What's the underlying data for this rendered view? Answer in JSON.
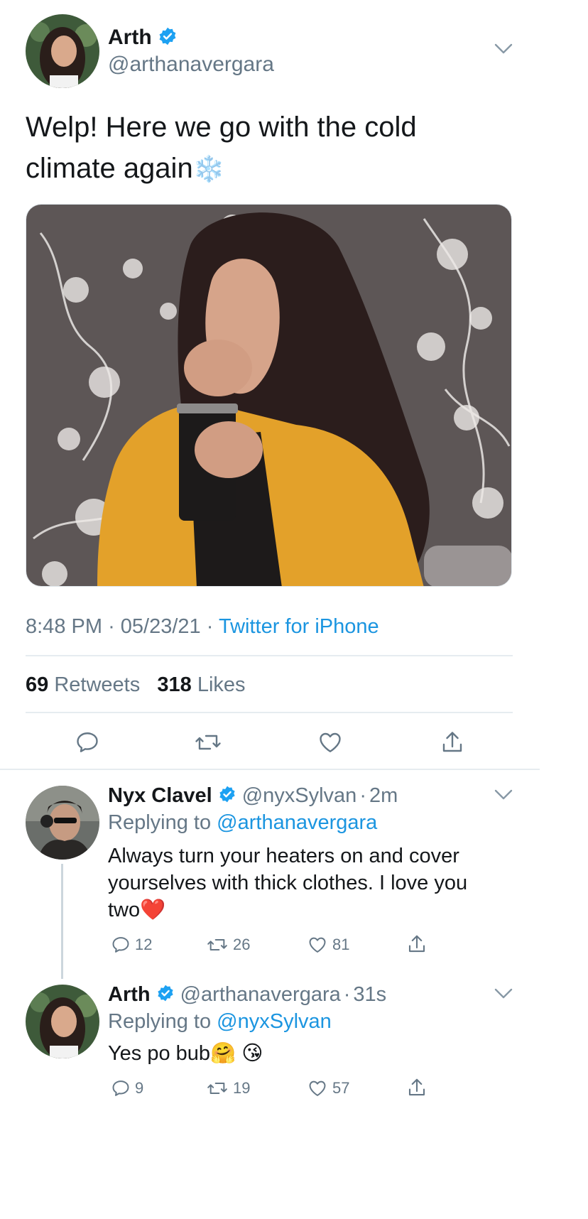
{
  "main_tweet": {
    "display_name": "Arth",
    "handle": "@arthanavergara",
    "text_line1": "Welp! Here we go with the cold",
    "text_line2": "climate again",
    "emoji_snowflake": "❄️",
    "time": "8:48 PM",
    "date": "05/23/21",
    "source": "Twitter for iPhone",
    "separator": "·",
    "retweets_count": "69",
    "retweets_label": "Retweets",
    "likes_count": "318",
    "likes_label": "Likes"
  },
  "replies": [
    {
      "display_name": "Nyx Clavel",
      "handle": "@nyxSylvan",
      "time": "2m",
      "replying_prefix": "Replying to",
      "replying_to": "@arthanavergara",
      "text_line1": "Always turn your heaters on and cover",
      "text_line2": "yourselves with thick clothes. I love you",
      "text_line3": "two",
      "emoji": "❤️",
      "replies": "12",
      "retweets": "26",
      "likes": "81"
    },
    {
      "display_name": "Arth",
      "handle": "@arthanavergara",
      "time": "31s",
      "replying_prefix": "Replying to",
      "replying_to": "@nyxSylvan",
      "text": "Yes po bub",
      "emoji1": "🤗",
      "emoji2": "😘",
      "replies": "9",
      "retweets": "19",
      "likes": "57"
    }
  ],
  "icons": {
    "reply": "reply-icon",
    "retweet": "retweet-icon",
    "like": "heart-icon",
    "share": "share-icon",
    "verified": "verified-badge-icon",
    "caret": "chevron-down-icon"
  },
  "colors": {
    "accent": "#1b95e0",
    "verified": "#1da1f2",
    "muted": "#657786",
    "text": "#14171a"
  }
}
